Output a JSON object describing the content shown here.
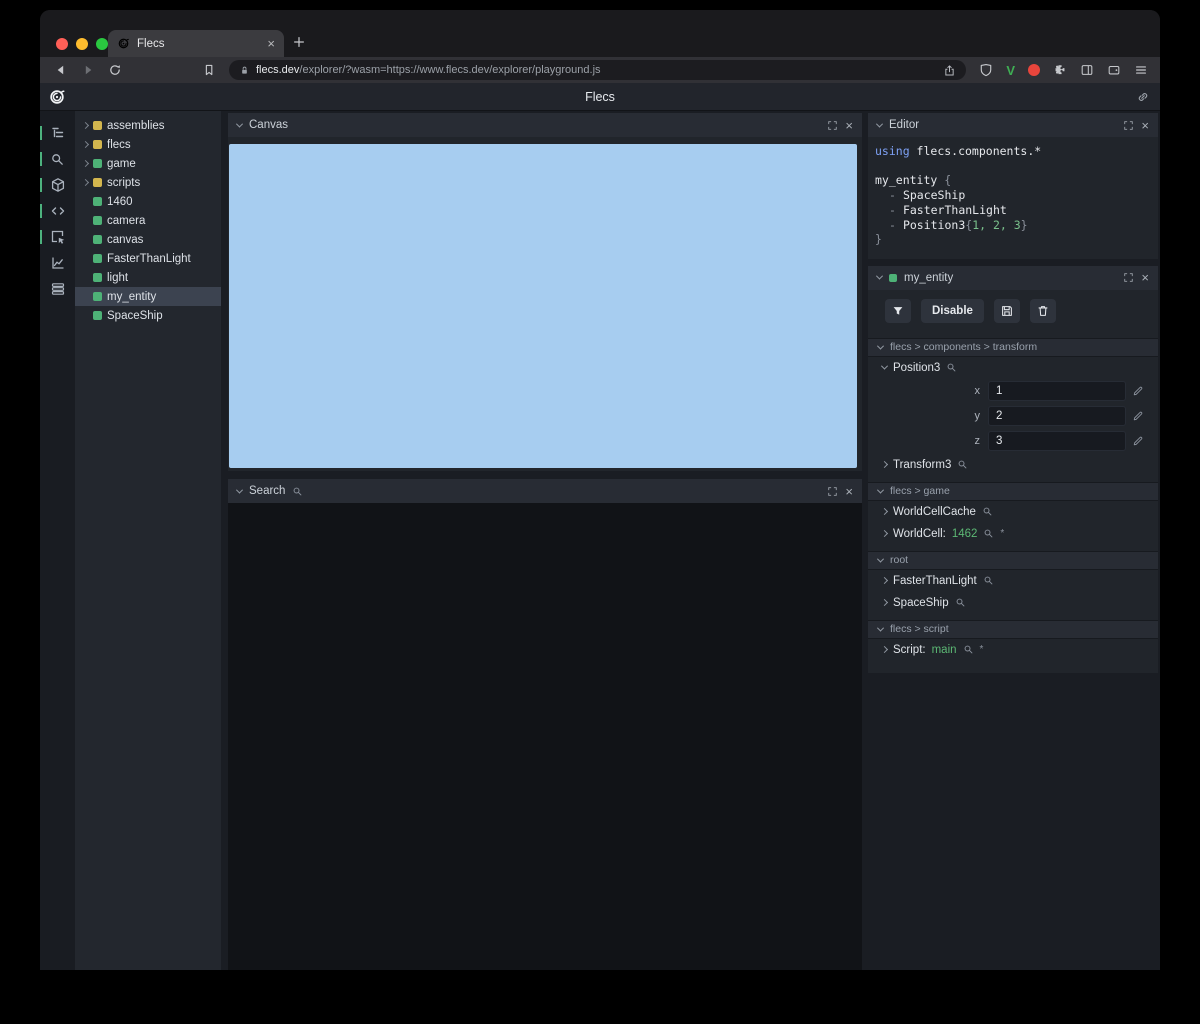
{
  "colors": {
    "traffic_red": "#ff5f57",
    "traffic_yellow": "#febc2e",
    "traffic_green": "#2ac840",
    "entity_green": "#4eb277",
    "module_yellow": "#d3b64e",
    "canvas_blue": "#a7cdf0",
    "code_keyword_blue": "#7ea1f5",
    "code_number_green": "#79c08b",
    "value_green": "#5cb874",
    "rail_active_green": "#4db27e"
  },
  "icons": {
    "close": "×",
    "new_tab": "+",
    "rail": [
      "tree-view-icon",
      "search-icon",
      "package-icon",
      "code-icon",
      "inspect-icon",
      "chart-icon",
      "rows-icon"
    ]
  },
  "browser": {
    "tab_title": "Flecs",
    "url": {
      "domain": "flecs.dev",
      "rest": "/explorer/?wasm=https://www.flecs.dev/explorer/playground.js"
    }
  },
  "app": {
    "title": "Flecs",
    "tree": {
      "items": [
        {
          "label": "assemblies",
          "kind": "module",
          "expandable": true
        },
        {
          "label": "flecs",
          "kind": "module",
          "expandable": true
        },
        {
          "label": "game",
          "kind": "entity",
          "expandable": true
        },
        {
          "label": "scripts",
          "kind": "module",
          "expandable": true
        },
        {
          "label": "1460",
          "kind": "entity"
        },
        {
          "label": "camera",
          "kind": "entity"
        },
        {
          "label": "canvas",
          "kind": "entity"
        },
        {
          "label": "FasterThanLight",
          "kind": "entity"
        },
        {
          "label": "light",
          "kind": "entity"
        },
        {
          "label": "my_entity",
          "kind": "entity",
          "selected": true
        },
        {
          "label": "SpaceShip",
          "kind": "entity"
        }
      ]
    },
    "canvas_panel": {
      "title": "Canvas"
    },
    "search_panel": {
      "title": "Search"
    },
    "editor": {
      "title": "Editor",
      "code": [
        {
          "kw": "using",
          "rest": " flecs.components.*"
        },
        {
          "blank": " "
        },
        {
          "name": "my_entity ",
          "brace": "{"
        },
        {
          "dash": "-",
          "name": "SpaceShip"
        },
        {
          "dash": "-",
          "name": "FasterThanLight"
        },
        {
          "dash": "-",
          "name": "Position3",
          "open": "{",
          "nums": "1, 2, 3",
          "close": "}"
        },
        {
          "brace": "}"
        }
      ]
    },
    "inspector": {
      "title": "my_entity",
      "disable_label": "Disable",
      "sections": [
        {
          "path": "flecs > components > transform",
          "components": [
            {
              "name": "Position3",
              "expanded": true,
              "fields": [
                {
                  "label": "x",
                  "value": "1"
                },
                {
                  "label": "y",
                  "value": "2"
                },
                {
                  "label": "z",
                  "value": "3"
                }
              ]
            },
            {
              "name": "Transform3"
            }
          ]
        },
        {
          "path": "flecs > game",
          "components": [
            {
              "name": "WorldCellCache"
            },
            {
              "name": "WorldCell:",
              "value": "1462",
              "annotation": "*"
            }
          ]
        },
        {
          "path": "root",
          "components": [
            {
              "name": "FasterThanLight"
            },
            {
              "name": "SpaceShip"
            }
          ]
        },
        {
          "path": "flecs > script",
          "components": [
            {
              "name": "Script:",
              "value": "main",
              "annotation": "*"
            }
          ]
        }
      ]
    }
  }
}
